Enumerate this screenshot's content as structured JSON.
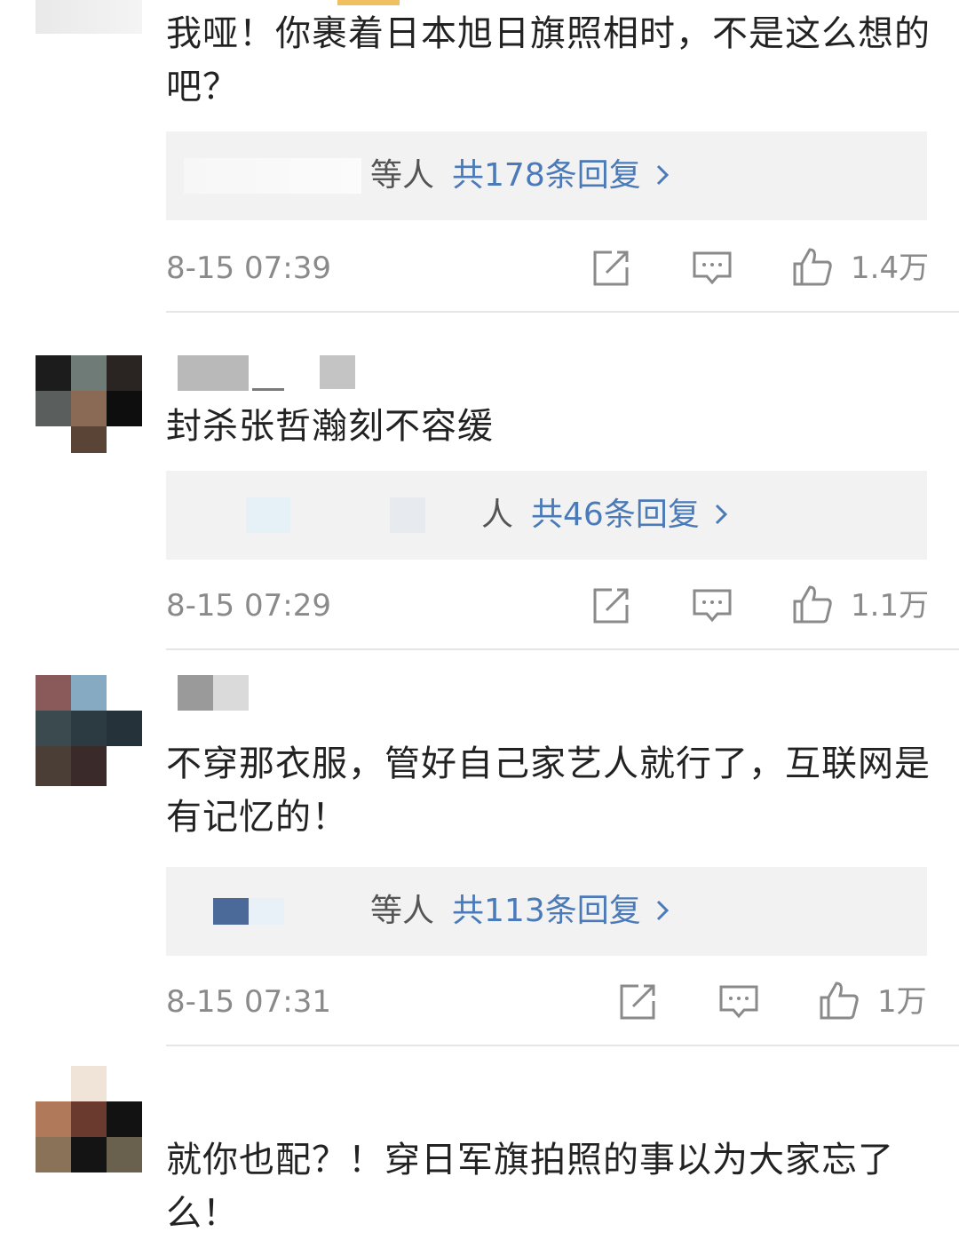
{
  "comments": [
    {
      "text": "我哑！你裹着日本旭日旗照相时，不是这么想的吧？",
      "reply_suffix": "等人",
      "reply_count": "共178条回复",
      "time": "8-15 07:39",
      "likes": "1.4万"
    },
    {
      "text": "封杀张哲瀚刻不容缓",
      "reply_suffix": "人",
      "reply_count": "共46条回复",
      "time": "8-15 07:29",
      "likes": "1.1万"
    },
    {
      "text": "不穿那衣服，管好自己家艺人就行了，互联网是有记忆的！",
      "reply_suffix": "等人",
      "reply_count": "共113条回复",
      "time": "8-15 07:31",
      "likes": "1万"
    },
    {
      "text": "就你也配？！穿日军旗拍照的事以为大家忘了么！"
    }
  ],
  "icons": [
    "repost-icon",
    "comment-icon",
    "like-icon",
    "chevron-right-icon"
  ],
  "colors": {
    "link": "#4a7ab8",
    "meta": "#8a8a8a",
    "reply_bg": "#f2f2f2"
  }
}
